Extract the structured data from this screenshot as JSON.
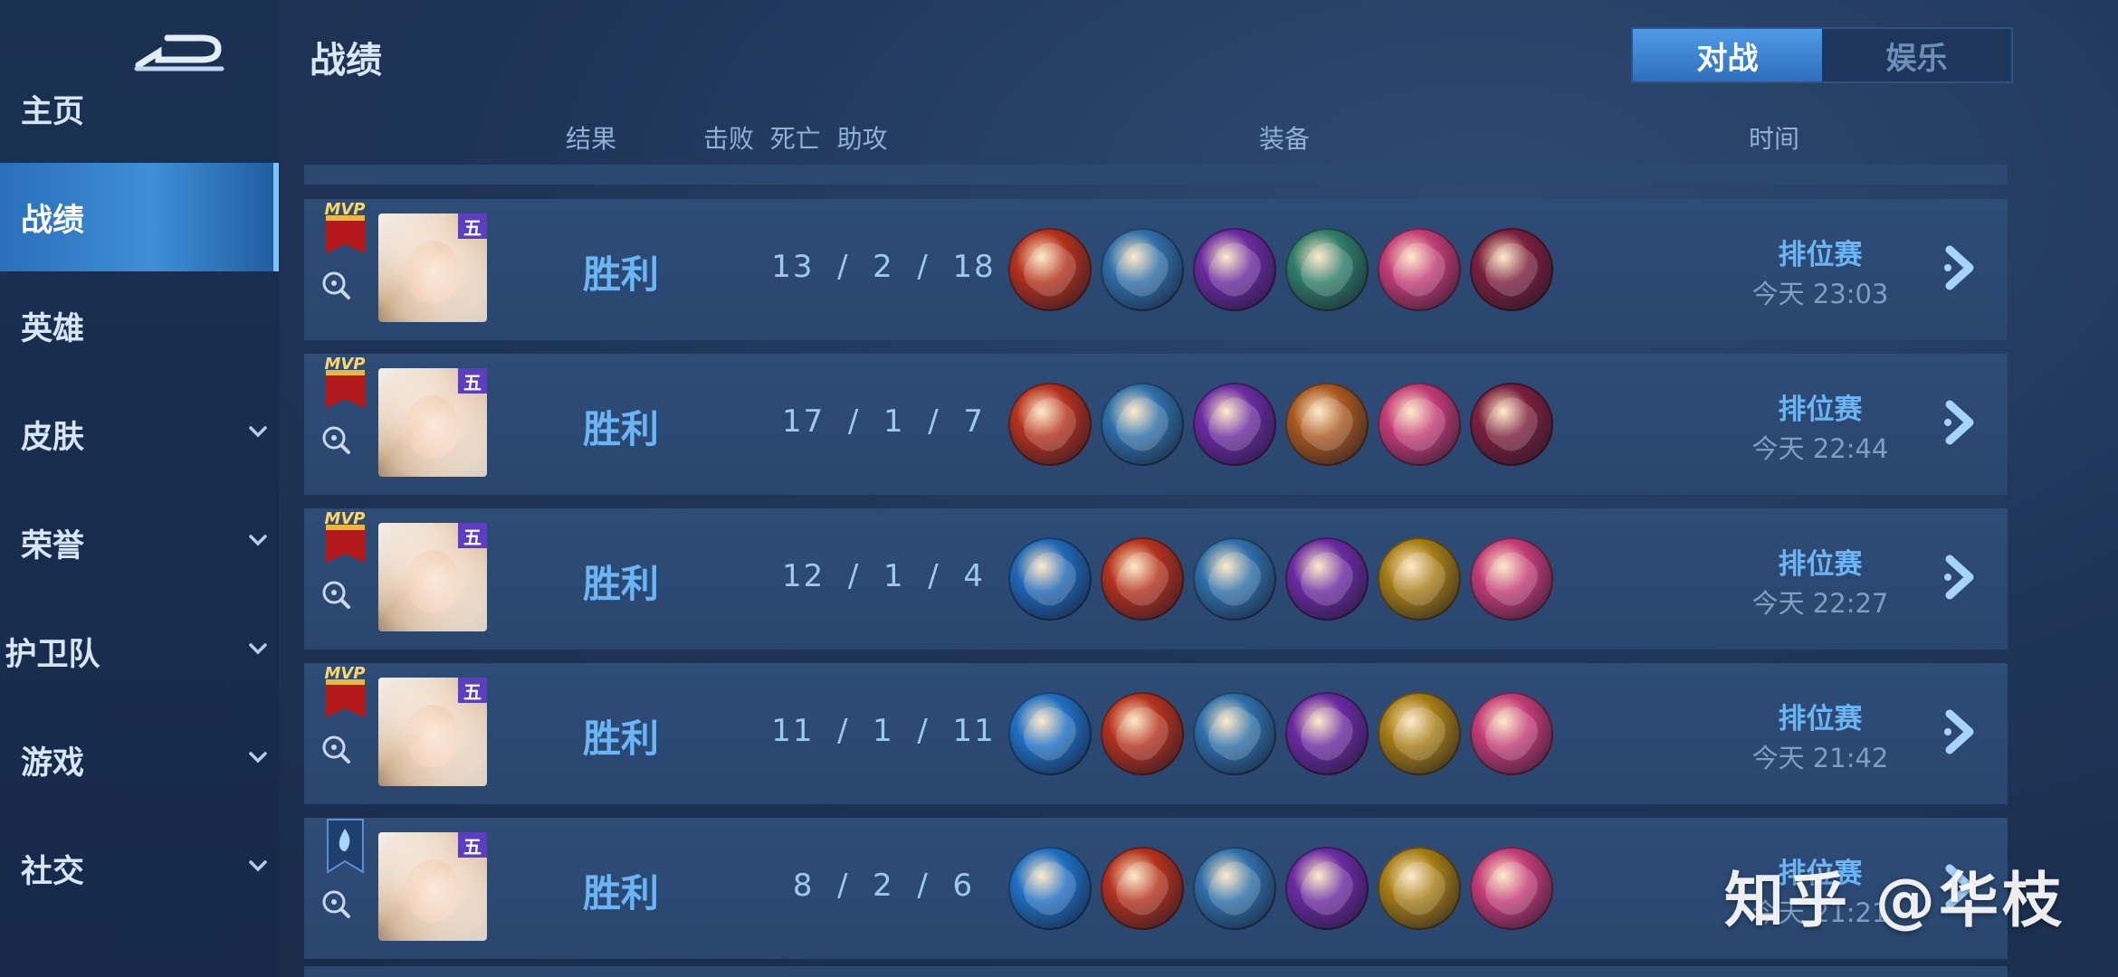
{
  "sidebar": {
    "items": [
      {
        "label": "主页",
        "has_chevron": false,
        "active": false
      },
      {
        "label": "战绩",
        "has_chevron": false,
        "active": true
      },
      {
        "label": "英雄",
        "has_chevron": false,
        "active": false
      },
      {
        "label": "皮肤",
        "has_chevron": true,
        "active": false
      },
      {
        "label": "荣誉",
        "has_chevron": true,
        "active": false
      },
      {
        "label": "护卫队",
        "has_chevron": true,
        "active": false
      },
      {
        "label": "游戏",
        "has_chevron": true,
        "active": false
      },
      {
        "label": "社交",
        "has_chevron": true,
        "active": false
      }
    ]
  },
  "header": {
    "title": "战绩",
    "tabs": [
      {
        "label": "对战",
        "active": true
      },
      {
        "label": "娱乐",
        "active": false
      }
    ]
  },
  "columns": {
    "result": "结果",
    "kda": "击败  死亡  助攻",
    "items": "装备",
    "time": "时间"
  },
  "matches": [
    {
      "badge": "MVP",
      "tier": "五",
      "result": "胜利",
      "kda": "13  /  2  /  18",
      "mode": "排位赛",
      "time": "今天 23:03",
      "items": [
        "red-axe-icon",
        "blue-orb-icon",
        "purple-spear-icon",
        "green-boots-icon",
        "pink-book-icon",
        "purple-hat-icon"
      ]
    },
    {
      "badge": "MVP",
      "tier": "五",
      "result": "胜利",
      "kda": "17  /  1  /  7",
      "mode": "排位赛",
      "time": "今天 22:44",
      "items": [
        "red-axe-icon",
        "blue-orb-icon",
        "purple-spear-icon",
        "orange-boots-icon",
        "pink-book-icon",
        "purple-hat-icon"
      ]
    },
    {
      "badge": "MVP",
      "tier": "五",
      "result": "胜利",
      "kda": "12  /  1  /  4",
      "mode": "排位赛",
      "time": "今天 22:27",
      "items": [
        "blue-sword-icon",
        "red-axe-icon",
        "blue-orb-icon",
        "purple-spear-icon",
        "gold-boots-icon",
        "pink-book-icon"
      ]
    },
    {
      "badge": "MVP",
      "tier": "五",
      "result": "胜利",
      "kda": "11  /  1  /  11",
      "mode": "排位赛",
      "time": "今天 21:42",
      "items": [
        "blue-staff-icon",
        "red-axe-icon",
        "blue-orb-icon",
        "purple-spear-icon",
        "gold-boots-icon",
        "pink-book-icon"
      ]
    },
    {
      "badge": "banner",
      "tier": "五",
      "result": "胜利",
      "kda": "8  /  2  /  6",
      "mode": "排位赛",
      "time": "今天 21:21",
      "items": [
        "blue-staff-icon",
        "red-axe-icon",
        "blue-orb-icon",
        "purple-spear-icon",
        "gold-boots-icon",
        "pink-book-icon"
      ]
    }
  ],
  "item_colors": {
    "red-axe-icon": "#b3311d",
    "blue-orb-icon": "#2e6fa8",
    "purple-spear-icon": "#6a2aa0",
    "green-boots-icon": "#2f7d6a",
    "orange-boots-icon": "#a8581f",
    "pink-book-icon": "#c23c76",
    "purple-hat-icon": "#7a1f3c",
    "blue-sword-icon": "#1e67b5",
    "blue-staff-icon": "#1f6fc2",
    "gold-boots-icon": "#a57d15"
  },
  "watermark": "知乎 @华枝",
  "colors": {
    "accent": "#6cb5f5",
    "active_nav": "#3f8fd8",
    "background": "#1c3050"
  }
}
